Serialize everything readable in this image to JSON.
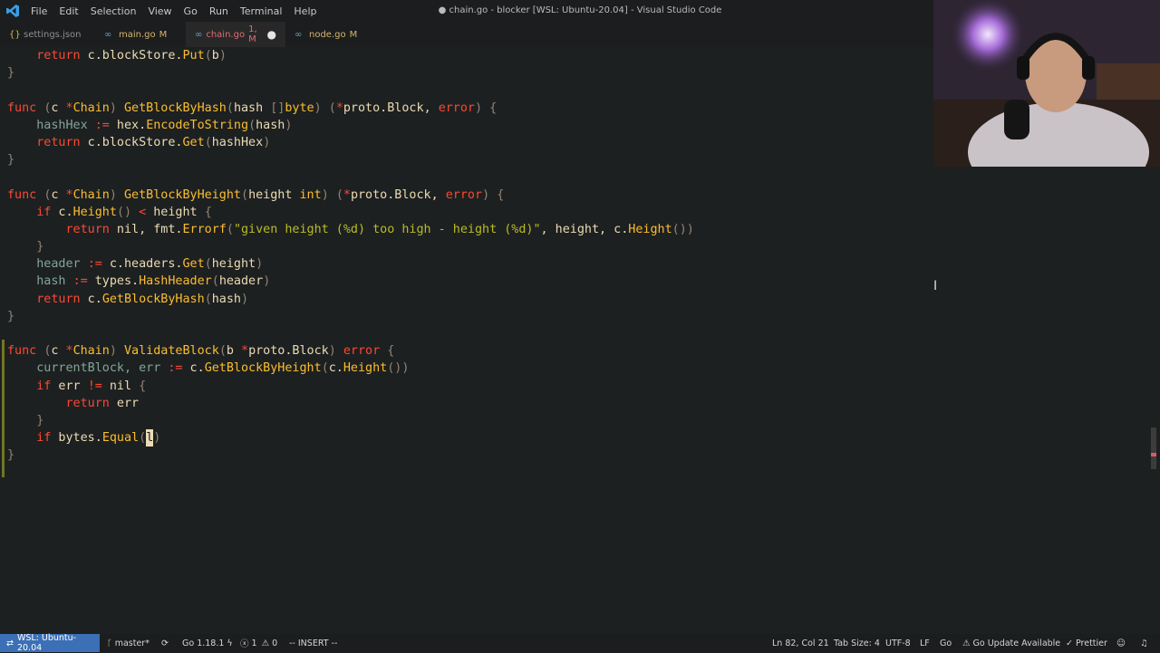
{
  "menu": [
    "File",
    "Edit",
    "Selection",
    "View",
    "Go",
    "Run",
    "Terminal",
    "Help"
  ],
  "window_title": "● chain.go - blocker [WSL: Ubuntu-20.04] - Visual Studio Code",
  "tabs": [
    {
      "icon": "{}",
      "label": "settings.json",
      "mod": ""
    },
    {
      "icon": "∞",
      "label": "main.go",
      "mod": "M"
    },
    {
      "icon": "∞",
      "label": "chain.go",
      "mod": "1, M"
    },
    {
      "icon": "∞",
      "label": "node.go",
      "mod": "M"
    }
  ],
  "tab_dirty": "●",
  "status": {
    "remote": "WSL: Ubuntu-20.04",
    "branch": "master*",
    "go_version": "Go 1.18.1",
    "errors": "1",
    "warnings": "0",
    "mode": "-- INSERT --",
    "position": "Ln 82, Col 21",
    "tab_size": "Tab Size: 4",
    "encoding": "UTF-8",
    "eol": "LF",
    "language": "Go",
    "update": "Go Update Available",
    "prettier": "Prettier"
  },
  "colors": {
    "remote_bg": "#3b6fb6",
    "editor_bg": "#1d2021",
    "keyword": "#fb4934",
    "function": "#fabd2f",
    "string": "#b8bb26"
  },
  "code_lines": [
    [
      [
        "    ",
        "v"
      ],
      [
        "return",
        "k"
      ],
      [
        " c.blockStore.",
        "v"
      ],
      [
        "Put",
        "f"
      ],
      [
        "(",
        "p"
      ],
      [
        "b",
        "v"
      ],
      [
        ")",
        "p"
      ]
    ],
    [
      [
        "}",
        "p"
      ]
    ],
    [
      [
        "",
        ""
      ]
    ],
    [
      [
        "func",
        "k"
      ],
      [
        " ",
        "v"
      ],
      [
        "(",
        "p"
      ],
      [
        "c ",
        "v"
      ],
      [
        "*",
        "k"
      ],
      [
        "Chain",
        "t"
      ],
      [
        ")",
        "p"
      ],
      [
        " ",
        "v"
      ],
      [
        "GetBlockByHash",
        "f"
      ],
      [
        "(",
        "p"
      ],
      [
        "hash ",
        "v"
      ],
      [
        "[]",
        "p"
      ],
      [
        "byte",
        "t"
      ],
      [
        ")",
        "p"
      ],
      [
        " ",
        "v"
      ],
      [
        "(",
        "p"
      ],
      [
        "*",
        "k"
      ],
      [
        "proto.Block",
        "v"
      ],
      [
        ", ",
        "v"
      ],
      [
        "error",
        "k"
      ],
      [
        ")",
        "p"
      ],
      [
        " ",
        "v"
      ],
      [
        "{",
        "p"
      ]
    ],
    [
      [
        "    hashHex ",
        "o"
      ],
      [
        ":=",
        "k"
      ],
      [
        " hex.",
        "v"
      ],
      [
        "EncodeToString",
        "f"
      ],
      [
        "(",
        "p"
      ],
      [
        "hash",
        "v"
      ],
      [
        ")",
        "p"
      ]
    ],
    [
      [
        "    ",
        "v"
      ],
      [
        "return",
        "k"
      ],
      [
        " c.blockStore.",
        "v"
      ],
      [
        "Get",
        "f"
      ],
      [
        "(",
        "p"
      ],
      [
        "hashHex",
        "v"
      ],
      [
        ")",
        "p"
      ]
    ],
    [
      [
        "}",
        "p"
      ]
    ],
    [
      [
        "",
        ""
      ]
    ],
    [
      [
        "func",
        "k"
      ],
      [
        " ",
        "v"
      ],
      [
        "(",
        "p"
      ],
      [
        "c ",
        "v"
      ],
      [
        "*",
        "k"
      ],
      [
        "Chain",
        "t"
      ],
      [
        ")",
        "p"
      ],
      [
        " ",
        "v"
      ],
      [
        "GetBlockByHeight",
        "f"
      ],
      [
        "(",
        "p"
      ],
      [
        "height ",
        "v"
      ],
      [
        "int",
        "t"
      ],
      [
        ")",
        "p"
      ],
      [
        " ",
        "v"
      ],
      [
        "(",
        "p"
      ],
      [
        "*",
        "k"
      ],
      [
        "proto.Block",
        "v"
      ],
      [
        ", ",
        "v"
      ],
      [
        "error",
        "k"
      ],
      [
        ")",
        "p"
      ],
      [
        " ",
        "v"
      ],
      [
        "{",
        "p"
      ]
    ],
    [
      [
        "    ",
        "v"
      ],
      [
        "if",
        "k"
      ],
      [
        " c.",
        "v"
      ],
      [
        "Height",
        "f"
      ],
      [
        "()",
        "p"
      ],
      [
        " ",
        "v"
      ],
      [
        "<",
        "k"
      ],
      [
        " height ",
        "v"
      ],
      [
        "{",
        "p"
      ]
    ],
    [
      [
        "        ",
        "v"
      ],
      [
        "return",
        "k"
      ],
      [
        " nil, fmt.",
        "v"
      ],
      [
        "Errorf",
        "f"
      ],
      [
        "(",
        "p"
      ],
      [
        "\"given height (%d) too high - height (%d)\"",
        "s"
      ],
      [
        ", height, c.",
        "v"
      ],
      [
        "Height",
        "f"
      ],
      [
        "())",
        "p"
      ]
    ],
    [
      [
        "    }",
        "p"
      ]
    ],
    [
      [
        "    header ",
        "o"
      ],
      [
        ":=",
        "k"
      ],
      [
        " c.headers.",
        "v"
      ],
      [
        "Get",
        "f"
      ],
      [
        "(",
        "p"
      ],
      [
        "height",
        "v"
      ],
      [
        ")",
        "p"
      ]
    ],
    [
      [
        "    hash ",
        "o"
      ],
      [
        ":=",
        "k"
      ],
      [
        " types.",
        "v"
      ],
      [
        "HashHeader",
        "f"
      ],
      [
        "(",
        "p"
      ],
      [
        "header",
        "v"
      ],
      [
        ")",
        "p"
      ]
    ],
    [
      [
        "    ",
        "v"
      ],
      [
        "return",
        "k"
      ],
      [
        " c.",
        "v"
      ],
      [
        "GetBlockByHash",
        "f"
      ],
      [
        "(",
        "p"
      ],
      [
        "hash",
        "v"
      ],
      [
        ")",
        "p"
      ]
    ],
    [
      [
        "}",
        "p"
      ]
    ],
    [
      [
        "",
        ""
      ]
    ],
    [
      [
        "func",
        "k"
      ],
      [
        " ",
        "v"
      ],
      [
        "(",
        "p"
      ],
      [
        "c ",
        "v"
      ],
      [
        "*",
        "k"
      ],
      [
        "Chain",
        "t"
      ],
      [
        ")",
        "p"
      ],
      [
        " ",
        "v"
      ],
      [
        "ValidateBlock",
        "f"
      ],
      [
        "(",
        "p"
      ],
      [
        "b ",
        "v"
      ],
      [
        "*",
        "k"
      ],
      [
        "proto.Block",
        "v"
      ],
      [
        ")",
        "p"
      ],
      [
        " ",
        "v"
      ],
      [
        "error",
        "k"
      ],
      [
        " ",
        "v"
      ],
      [
        "{",
        "p"
      ]
    ],
    [
      [
        "    currentBlock, err ",
        "o"
      ],
      [
        ":=",
        "k"
      ],
      [
        " c.",
        "v"
      ],
      [
        "GetBlockByHeight",
        "f"
      ],
      [
        "(",
        "p"
      ],
      [
        "c.",
        "v"
      ],
      [
        "Height",
        "f"
      ],
      [
        "())",
        "p"
      ]
    ],
    [
      [
        "    ",
        "v"
      ],
      [
        "if",
        "k"
      ],
      [
        " err ",
        "v"
      ],
      [
        "!=",
        "k"
      ],
      [
        " nil ",
        "v"
      ],
      [
        "{",
        "p"
      ]
    ],
    [
      [
        "        ",
        "v"
      ],
      [
        "return",
        "k"
      ],
      [
        " err",
        "v"
      ]
    ],
    [
      [
        "    }",
        "p"
      ]
    ],
    [
      [
        "    ",
        "v"
      ],
      [
        "if",
        "k"
      ],
      [
        " bytes.",
        "v"
      ],
      [
        "Equal",
        "f"
      ],
      [
        "(",
        "p"
      ],
      [
        "l",
        "cur"
      ],
      [
        ")",
        "p"
      ]
    ],
    [
      [
        "}",
        "p"
      ]
    ]
  ]
}
